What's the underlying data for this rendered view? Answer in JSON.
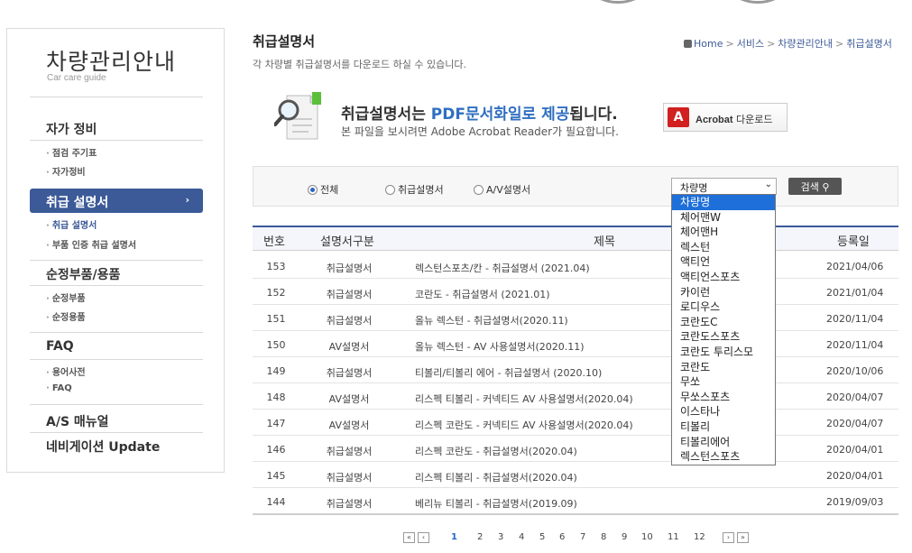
{
  "sidebar": {
    "title": "차량관리안내",
    "subtitle": "Car care guide",
    "groups": [
      {
        "label": "자가 정비",
        "items": [
          "점검 주기표",
          "자가정비"
        ]
      },
      {
        "label": "취급 설명서",
        "items": [
          "취급 설명서",
          "부품 인증 취급 설명서"
        ]
      },
      {
        "label": "순정부품/용품",
        "items": [
          "순정부품",
          "순정용품"
        ]
      },
      {
        "label": "FAQ",
        "items": [
          "용어사전",
          "FAQ"
        ]
      },
      {
        "label": "A/S 매뉴얼",
        "items": []
      },
      {
        "label": "네비게이션 Update",
        "items": []
      }
    ]
  },
  "header": {
    "title": "취급설명서",
    "description": "각 차량별 취급설명서를 다운로드 하실 수 있습니다.",
    "breadcrumb": [
      "Home",
      "서비스",
      "차량관리안내",
      "취급설명서"
    ],
    "breadcrumb_sep": ">"
  },
  "banner": {
    "line_prefix": "취급설명서는 ",
    "line_highlight": "PDF문서화일로 제공",
    "line_suffix": "됩니다.",
    "sub": "본 파일을 보시려면 Adobe Acrobat Reader가 필요합니다.",
    "acrobat_brand": "Acrobat",
    "acrobat_label": " 다운로드"
  },
  "search": {
    "radios": [
      {
        "label": "전체",
        "checked": true
      },
      {
        "label": "취급설명서",
        "checked": false
      },
      {
        "label": "A/V설명서",
        "checked": false
      }
    ],
    "select_value": "차량명",
    "button_label": "검색",
    "options": [
      "차량명",
      "체어맨W",
      "체어맨H",
      "렉스턴",
      "액티언",
      "액티언스포츠",
      "카이런",
      "로디우스",
      "코란도C",
      "코란도스포츠",
      "코란도 투리스모",
      "코란도",
      "무쏘",
      "무쏘스포츠",
      "이스타나",
      "티볼리",
      "티볼리에어",
      "렉스턴스포츠"
    ]
  },
  "table": {
    "headers": [
      "번호",
      "설명서구분",
      "제목",
      "등록일"
    ],
    "rows": [
      {
        "no": "153",
        "type": "취급설명서",
        "title": "렉스턴스포츠/칸 - 취급설명서 (2021.04)",
        "date": "2021/04/06"
      },
      {
        "no": "152",
        "type": "취급설명서",
        "title": "코란도 - 취급설명서 (2021.01)",
        "date": "2021/01/04"
      },
      {
        "no": "151",
        "type": "취급설명서",
        "title": "올뉴 렉스턴 - 취급설명서(2020.11)",
        "date": "2020/11/04"
      },
      {
        "no": "150",
        "type": "AV설명서",
        "title": "올뉴 렉스턴 - AV 사용설명서(2020.11)",
        "date": "2020/11/04"
      },
      {
        "no": "149",
        "type": "취급설명서",
        "title": "티볼리/티볼리 에어 - 취급설명서 (2020.10)",
        "date": "2020/10/06"
      },
      {
        "no": "148",
        "type": "AV설명서",
        "title": "리스펙 티볼리 - 커넥티드 AV 사용설명서(2020.04)",
        "date": "2020/04/07"
      },
      {
        "no": "147",
        "type": "AV설명서",
        "title": "리스펙 코란도 - 커넥티드 AV 사용설명서(2020.04)",
        "date": "2020/04/07"
      },
      {
        "no": "146",
        "type": "취급설명서",
        "title": "리스펙 코란도 - 취급설명서(2020.04)",
        "date": "2020/04/01"
      },
      {
        "no": "145",
        "type": "취급설명서",
        "title": "리스펙 티볼리 - 취급설명서(2020.04)",
        "date": "2020/04/01"
      },
      {
        "no": "144",
        "type": "취급설명서",
        "title": "베리뉴 티볼리 - 취급설명서(2019.09)",
        "date": "2019/09/03"
      }
    ]
  },
  "pagination": {
    "first": "«",
    "prev": "‹",
    "pages": [
      "1",
      "2",
      "3",
      "4",
      "5",
      "6",
      "7",
      "8",
      "9",
      "10",
      "11",
      "12"
    ],
    "current": "1",
    "next": "›",
    "last": "»"
  }
}
